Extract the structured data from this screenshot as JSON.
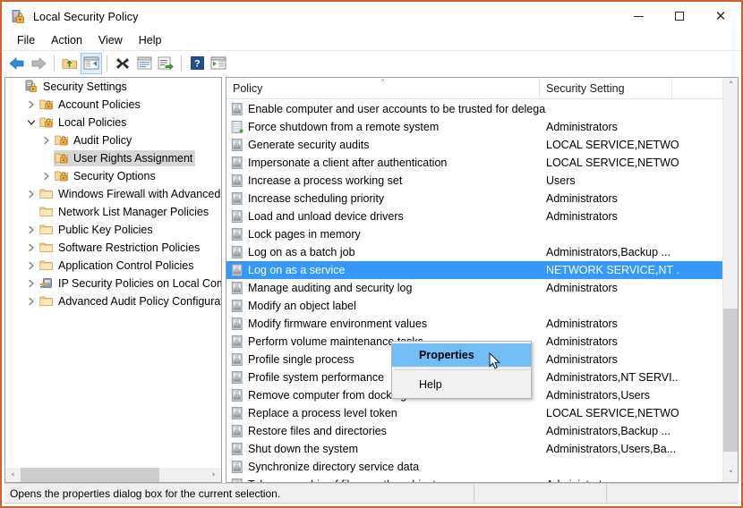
{
  "window": {
    "title": "Local Security Policy",
    "icon": "security-policy-icon",
    "minimize_label": "Minimize",
    "maximize_label": "Maximize",
    "close_label": "Close"
  },
  "menubar": {
    "items": [
      {
        "label": "File"
      },
      {
        "label": "Action"
      },
      {
        "label": "View"
      },
      {
        "label": "Help"
      }
    ]
  },
  "toolbar": {
    "buttons": [
      {
        "name": "back-button",
        "icon": "back-arrow-icon"
      },
      {
        "name": "forward-button",
        "icon": "forward-arrow-icon"
      },
      {
        "name": "up-one-level-button",
        "icon": "folder-up-icon"
      },
      {
        "name": "show-hide-console-tree-button",
        "icon": "console-tree-icon",
        "pressed": true
      },
      {
        "name": "delete-button",
        "icon": "delete-x-icon"
      },
      {
        "name": "properties-button",
        "icon": "properties-icon"
      },
      {
        "name": "export-list-button",
        "icon": "export-list-icon"
      },
      {
        "name": "help-button",
        "icon": "help-question-icon"
      },
      {
        "name": "filter-button",
        "icon": "filter-window-icon"
      }
    ]
  },
  "tree": {
    "items": [
      {
        "label": "Security Settings",
        "indent": 0,
        "expander": "none",
        "icon": "security-settings-icon",
        "selected": false
      },
      {
        "label": "Account Policies",
        "indent": 1,
        "expander": "collapsed",
        "icon": "policy-folder-icon",
        "selected": false
      },
      {
        "label": "Local Policies",
        "indent": 1,
        "expander": "expanded",
        "icon": "policy-folder-icon",
        "selected": false
      },
      {
        "label": "Audit Policy",
        "indent": 2,
        "expander": "collapsed",
        "icon": "policy-folder-icon",
        "selected": false
      },
      {
        "label": "User Rights Assignment",
        "indent": 2,
        "expander": "none",
        "icon": "policy-folder-icon",
        "selected": true
      },
      {
        "label": "Security Options",
        "indent": 2,
        "expander": "collapsed",
        "icon": "policy-folder-icon",
        "selected": false
      },
      {
        "label": "Windows Firewall with Advanced Secu",
        "indent": 1,
        "expander": "collapsed",
        "icon": "folder-icon",
        "selected": false
      },
      {
        "label": "Network List Manager Policies",
        "indent": 1,
        "expander": "none",
        "icon": "folder-icon",
        "selected": false
      },
      {
        "label": "Public Key Policies",
        "indent": 1,
        "expander": "collapsed",
        "icon": "folder-icon",
        "selected": false
      },
      {
        "label": "Software Restriction Policies",
        "indent": 1,
        "expander": "collapsed",
        "icon": "folder-icon",
        "selected": false
      },
      {
        "label": "Application Control Policies",
        "indent": 1,
        "expander": "collapsed",
        "icon": "folder-icon",
        "selected": false
      },
      {
        "label": "IP Security Policies on Local Compute",
        "indent": 1,
        "expander": "collapsed",
        "icon": "ip-security-icon",
        "selected": false
      },
      {
        "label": "Advanced Audit Policy Configuration",
        "indent": 1,
        "expander": "collapsed",
        "icon": "folder-icon",
        "selected": false
      }
    ],
    "hscroll": {
      "left_arrow": "‹",
      "right_arrow": "›"
    }
  },
  "list": {
    "columns": [
      {
        "label": "Policy",
        "sorted": "ascending"
      },
      {
        "label": "Security Setting"
      },
      {
        "label": ""
      }
    ],
    "sort_indicator": "˄",
    "rows": [
      {
        "policy": "Enable computer and user accounts to be trusted for delega...",
        "setting": "",
        "icon": "policy-binary-icon",
        "selected": false
      },
      {
        "policy": "Force shutdown from a remote system",
        "setting": "Administrators",
        "icon": "policy-server-icon",
        "selected": false
      },
      {
        "policy": "Generate security audits",
        "setting": "LOCAL SERVICE,NETWO...",
        "icon": "policy-binary-icon",
        "selected": false
      },
      {
        "policy": "Impersonate a client after authentication",
        "setting": "LOCAL SERVICE,NETWO...",
        "icon": "policy-binary-icon",
        "selected": false
      },
      {
        "policy": "Increase a process working set",
        "setting": "Users",
        "icon": "policy-binary-icon",
        "selected": false
      },
      {
        "policy": "Increase scheduling priority",
        "setting": "Administrators",
        "icon": "policy-binary-icon",
        "selected": false
      },
      {
        "policy": "Load and unload device drivers",
        "setting": "Administrators",
        "icon": "policy-binary-icon",
        "selected": false
      },
      {
        "policy": "Lock pages in memory",
        "setting": "",
        "icon": "policy-binary-icon",
        "selected": false
      },
      {
        "policy": "Log on as a batch job",
        "setting": "Administrators,Backup ...",
        "icon": "policy-binary-icon",
        "selected": false
      },
      {
        "policy": "Log on as a service",
        "setting": "NETWORK SERVICE,NT ...",
        "icon": "policy-binary-icon",
        "selected": true
      },
      {
        "policy": "Manage auditing and security log",
        "setting": "Administrators",
        "icon": "policy-binary-icon",
        "selected": false
      },
      {
        "policy": "Modify an object label",
        "setting": "",
        "icon": "policy-binary-icon",
        "selected": false
      },
      {
        "policy": "Modify firmware environment values",
        "setting": "Administrators",
        "icon": "policy-binary-icon",
        "selected": false
      },
      {
        "policy": "Perform volume maintenance tasks",
        "setting": "Administrators",
        "icon": "policy-binary-icon",
        "selected": false
      },
      {
        "policy": "Profile single process",
        "setting": "Administrators",
        "icon": "policy-binary-icon",
        "selected": false
      },
      {
        "policy": "Profile system performance",
        "setting": "Administrators,NT SERVI...",
        "icon": "policy-binary-icon",
        "selected": false
      },
      {
        "policy": "Remove computer from docking station",
        "setting": "Administrators,Users",
        "icon": "policy-binary-icon",
        "selected": false
      },
      {
        "policy": "Replace a process level token",
        "setting": "LOCAL SERVICE,NETWO...",
        "icon": "policy-binary-icon",
        "selected": false
      },
      {
        "policy": "Restore files and directories",
        "setting": "Administrators,Backup ...",
        "icon": "policy-binary-icon",
        "selected": false
      },
      {
        "policy": "Shut down the system",
        "setting": "Administrators,Users,Ba...",
        "icon": "policy-binary-icon",
        "selected": false
      },
      {
        "policy": "Synchronize directory service data",
        "setting": "",
        "icon": "policy-binary-icon",
        "selected": false
      },
      {
        "policy": "Take ownership of files or other objects",
        "setting": "Administrators",
        "icon": "policy-binary-icon",
        "selected": false
      }
    ],
    "vscroll": {
      "up_arrow": "˄",
      "down_arrow": "˅"
    }
  },
  "context_menu": {
    "items": [
      {
        "label": "Properties",
        "highlighted": true
      },
      {
        "separator": true
      },
      {
        "label": "Help",
        "highlighted": false
      }
    ]
  },
  "statusbar": {
    "message": "Opens the properties dialog box for the current selection."
  },
  "colors": {
    "selection_blue": "#3399ff",
    "menu_highlight": "#71bdf5",
    "window_border": "#d35f2a",
    "tree_selection": "#d6d6d6"
  }
}
